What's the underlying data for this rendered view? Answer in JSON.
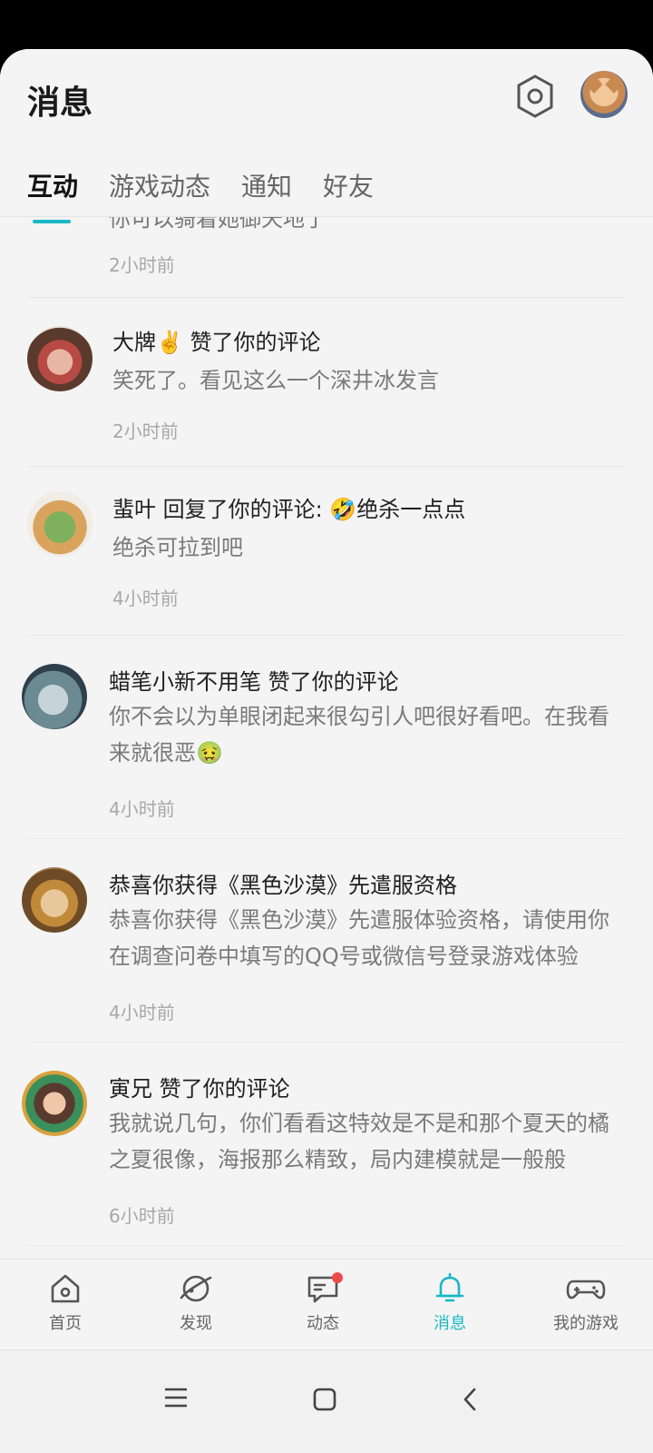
{
  "header": {
    "title": "消息",
    "settings_icon": "settings-hex-icon"
  },
  "tabs": [
    {
      "label": "互动",
      "active": true
    },
    {
      "label": "游戏动态",
      "active": false
    },
    {
      "label": "通知",
      "active": false
    },
    {
      "label": "好友",
      "active": false
    }
  ],
  "partial_item": {
    "text": "你可以骑着她御天地了",
    "time": "2小时前"
  },
  "items": [
    {
      "name": "大牌✌️ 赞了你的评论",
      "body": "笑死了。看见这么一个深井冰发言",
      "time": "2小时前"
    },
    {
      "name": "蜚叶 回复了你的评论: 🤣绝杀一点点",
      "body": "绝杀可拉到吧",
      "time": "4小时前"
    },
    {
      "name": "蜡笔小新不用笔 赞了你的评论",
      "body": "你不会以为单眼闭起来很勾引人吧很好看吧。在我看来就很恶🤢",
      "time": "4小时前"
    },
    {
      "name": "恭喜你获得《黑色沙漠》先遣服资格",
      "body": "恭喜你获得《黑色沙漠》先遣服体验资格，请使用你在调查问卷中填写的QQ号或微信号登录游戏体验",
      "time": "4小时前"
    },
    {
      "name": "寅兄 赞了你的评论",
      "body": "我就说几句，你们看看这特效是不是和那个夏天的橘之夏很像，海报那么精致，局内建模就是一般般",
      "time": "6小时前"
    }
  ],
  "bottom_nav": [
    {
      "label": "首页",
      "icon": "home-icon",
      "active": false
    },
    {
      "label": "发现",
      "icon": "planet-icon",
      "active": false
    },
    {
      "label": "动态",
      "icon": "chat-icon",
      "active": false,
      "badge": true
    },
    {
      "label": "消息",
      "icon": "bell-icon",
      "active": true
    },
    {
      "label": "我的游戏",
      "icon": "gamepad-icon",
      "active": false
    }
  ],
  "colors": {
    "accent": "#18b8c4",
    "badge": "#ef4a4a"
  }
}
